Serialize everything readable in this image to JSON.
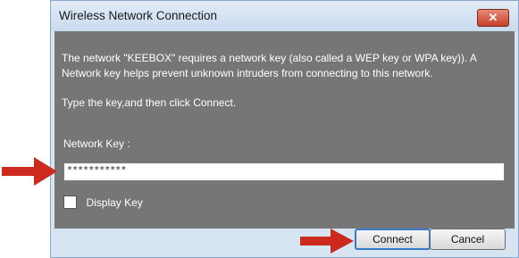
{
  "window": {
    "title": "Wireless Network Connection",
    "close_glyph": "✕"
  },
  "content": {
    "message": "The network \"KEEBOX\" requires a network key (also called a WEP key or WPA key)). A Network key helps prevent unknown intruders from connecting to this network.",
    "instruction": "Type the key,and then click Connect.",
    "network_key_label": "Network Key :",
    "network_key_value": "***********",
    "display_key_label": "Display Key",
    "display_key_checked": false
  },
  "buttons": {
    "connect": "Connect",
    "cancel": "Cancel"
  },
  "annotation": {
    "arrow_color": "#cc2a1e"
  }
}
